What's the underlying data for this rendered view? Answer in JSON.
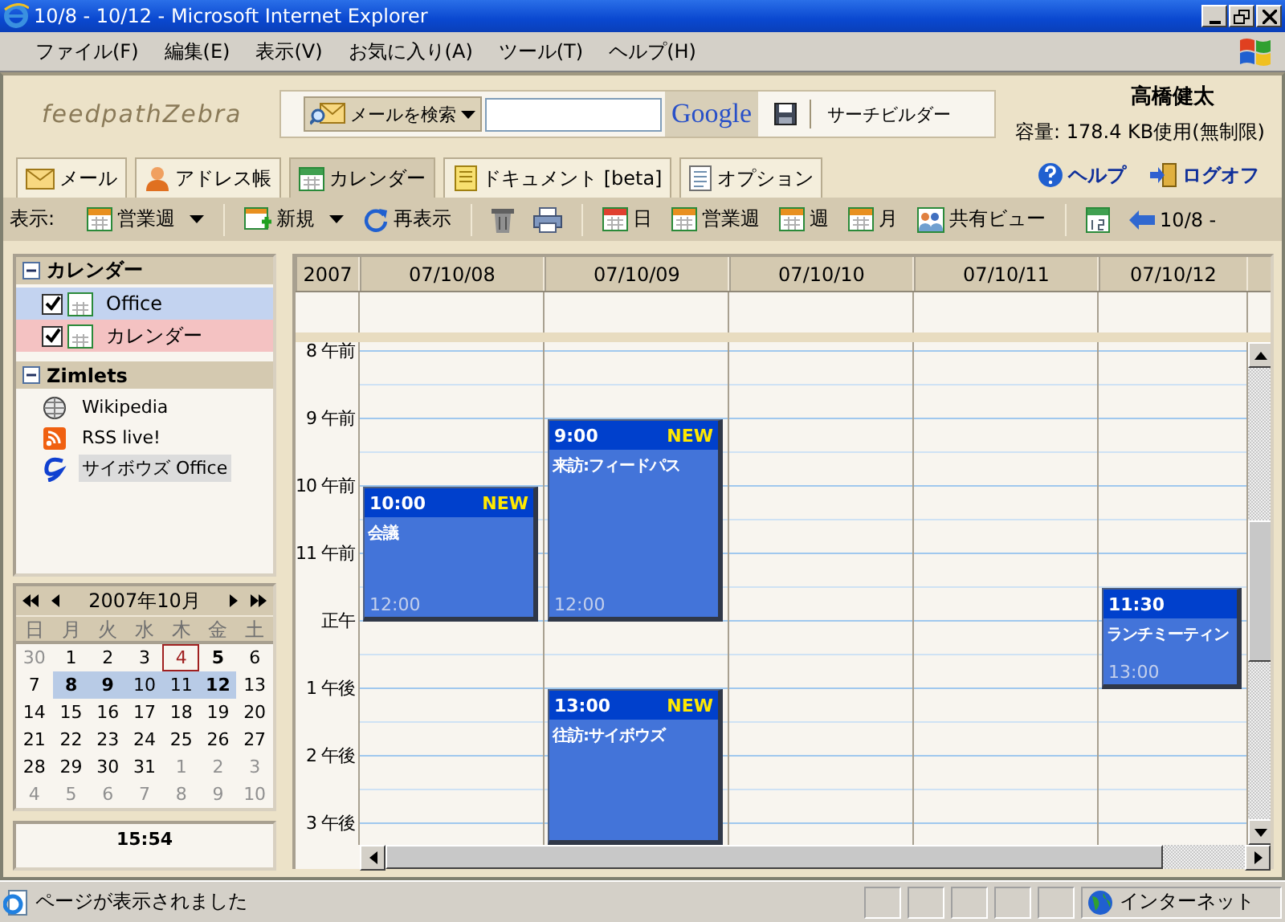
{
  "window": {
    "title": "10/8 - 10/12 - Microsoft Internet Explorer"
  },
  "menu": [
    "ファイル(F)",
    "編集(E)",
    "表示(V)",
    "お気に入り(A)",
    "ツール(T)",
    "ヘルプ(H)"
  ],
  "header": {
    "logo": "feedpathZebra",
    "search_scope": "メールを検索",
    "search_button": "Google",
    "search_builder": "サーチビルダー",
    "user": "高橋健太",
    "quota": "容量: 178.4 KB使用(無制限)"
  },
  "tabs": [
    {
      "label": "メール",
      "selected": false
    },
    {
      "label": "アドレス帳",
      "selected": false
    },
    {
      "label": "カレンダー",
      "selected": true
    },
    {
      "label": "ドキュメント [beta]",
      "selected": false
    },
    {
      "label": "オプション",
      "selected": false
    }
  ],
  "links": [
    "ヘルプ",
    "ログオフ"
  ],
  "toolbar": [
    {
      "kind": "label",
      "text": "表示:"
    },
    {
      "kind": "dropdown",
      "text": "営業週"
    },
    {
      "kind": "separator"
    },
    {
      "kind": "dropdown",
      "text": "新規"
    },
    {
      "kind": "button",
      "text": "再表示"
    },
    {
      "kind": "separator"
    },
    {
      "kind": "icon"
    },
    {
      "kind": "icon"
    },
    {
      "kind": "separator"
    },
    {
      "kind": "button",
      "text": "日"
    },
    {
      "kind": "button",
      "text": "営業週"
    },
    {
      "kind": "button",
      "text": "週"
    },
    {
      "kind": "button",
      "text": "月"
    },
    {
      "kind": "button",
      "text": "共有ビュー"
    },
    {
      "kind": "separator"
    },
    {
      "kind": "icon"
    },
    {
      "kind": "button",
      "text": "10/8 -"
    }
  ],
  "sidebar": {
    "calendars": {
      "title": "カレンダー",
      "items": [
        {
          "label": "Office",
          "checked": true,
          "color": "#c3d3f0"
        },
        {
          "label": "カレンダー",
          "checked": true,
          "color": "#f4c2c2"
        }
      ]
    },
    "zimlets": {
      "title": "Zimlets",
      "items": [
        {
          "label": "Wikipedia",
          "selected": false
        },
        {
          "label": "RSS live!",
          "selected": false
        },
        {
          "label": "サイボウズ Office",
          "selected": true
        }
      ]
    }
  },
  "mini_calendar": {
    "title": "2007年10月",
    "weekdays": [
      "日",
      "月",
      "火",
      "水",
      "木",
      "金",
      "土"
    ],
    "weeks": [
      [
        {
          "text": "30",
          "outside": true,
          "busy": false,
          "selected": false,
          "today": false
        },
        {
          "text": "1",
          "outside": false,
          "busy": false,
          "selected": false,
          "today": false
        },
        {
          "text": "2",
          "outside": false,
          "busy": false,
          "selected": false,
          "today": false
        },
        {
          "text": "3",
          "outside": false,
          "busy": false,
          "selected": false,
          "today": false
        },
        {
          "text": "4",
          "outside": false,
          "busy": false,
          "selected": false,
          "today": true
        },
        {
          "text": "5",
          "outside": false,
          "busy": true,
          "selected": false,
          "today": false
        },
        {
          "text": "6",
          "outside": false,
          "busy": false,
          "selected": false,
          "today": false
        }
      ],
      [
        {
          "text": "7",
          "outside": false,
          "busy": false,
          "selected": false,
          "today": false
        },
        {
          "text": "8",
          "outside": false,
          "busy": true,
          "selected": true,
          "today": false
        },
        {
          "text": "9",
          "outside": false,
          "busy": true,
          "selected": true,
          "today": false
        },
        {
          "text": "10",
          "outside": false,
          "busy": false,
          "selected": true,
          "today": false
        },
        {
          "text": "11",
          "outside": false,
          "busy": false,
          "selected": true,
          "today": false
        },
        {
          "text": "12",
          "outside": false,
          "busy": true,
          "selected": true,
          "today": false
        },
        {
          "text": "13",
          "outside": false,
          "busy": false,
          "selected": false,
          "today": false
        }
      ],
      [
        {
          "text": "14",
          "outside": false,
          "busy": false,
          "selected": false,
          "today": false
        },
        {
          "text": "15",
          "outside": false,
          "busy": false,
          "selected": false,
          "today": false
        },
        {
          "text": "16",
          "outside": false,
          "busy": false,
          "selected": false,
          "today": false
        },
        {
          "text": "17",
          "outside": false,
          "busy": false,
          "selected": false,
          "today": false
        },
        {
          "text": "18",
          "outside": false,
          "busy": false,
          "selected": false,
          "today": false
        },
        {
          "text": "19",
          "outside": false,
          "busy": false,
          "selected": false,
          "today": false
        },
        {
          "text": "20",
          "outside": false,
          "busy": false,
          "selected": false,
          "today": false
        }
      ],
      [
        {
          "text": "21",
          "outside": false,
          "busy": false,
          "selected": false,
          "today": false
        },
        {
          "text": "22",
          "outside": false,
          "busy": false,
          "selected": false,
          "today": false
        },
        {
          "text": "23",
          "outside": false,
          "busy": false,
          "selected": false,
          "today": false
        },
        {
          "text": "24",
          "outside": false,
          "busy": false,
          "selected": false,
          "today": false
        },
        {
          "text": "25",
          "outside": false,
          "busy": false,
          "selected": false,
          "today": false
        },
        {
          "text": "26",
          "outside": false,
          "busy": false,
          "selected": false,
          "today": false
        },
        {
          "text": "27",
          "outside": false,
          "busy": false,
          "selected": false,
          "today": false
        }
      ],
      [
        {
          "text": "28",
          "outside": false,
          "busy": false,
          "selected": false,
          "today": false
        },
        {
          "text": "29",
          "outside": false,
          "busy": false,
          "selected": false,
          "today": false
        },
        {
          "text": "30",
          "outside": false,
          "busy": false,
          "selected": false,
          "today": false
        },
        {
          "text": "31",
          "outside": false,
          "busy": false,
          "selected": false,
          "today": false
        },
        {
          "text": "1",
          "outside": true,
          "busy": false,
          "selected": false,
          "today": false
        },
        {
          "text": "2",
          "outside": true,
          "busy": false,
          "selected": false,
          "today": false
        },
        {
          "text": "3",
          "outside": true,
          "busy": false,
          "selected": false,
          "today": false
        }
      ],
      [
        {
          "text": "4",
          "outside": true,
          "busy": false,
          "selected": false,
          "today": false
        },
        {
          "text": "5",
          "outside": true,
          "busy": false,
          "selected": false,
          "today": false
        },
        {
          "text": "6",
          "outside": true,
          "busy": false,
          "selected": false,
          "today": false
        },
        {
          "text": "7",
          "outside": true,
          "busy": false,
          "selected": false,
          "today": false
        },
        {
          "text": "8",
          "outside": true,
          "busy": false,
          "selected": false,
          "today": false
        },
        {
          "text": "9",
          "outside": true,
          "busy": false,
          "selected": false,
          "today": false
        },
        {
          "text": "10",
          "outside": true,
          "busy": false,
          "selected": false,
          "today": false
        }
      ]
    ]
  },
  "clock": "15:54",
  "calendar": {
    "year": "2007",
    "hours": [
      "8 午前",
      "9 午前",
      "10 午前",
      "11 午前",
      "正午",
      "1 午後",
      "2 午後",
      "3 午後"
    ],
    "days": [
      {
        "date": "07/10/08",
        "events": [
          {
            "start": "10:00",
            "end": "12:00",
            "title": "会議",
            "badge": "NEW"
          }
        ]
      },
      {
        "date": "07/10/09",
        "events": [
          {
            "start": "9:00",
            "end": "12:00",
            "title": "来訪:フィードパス",
            "badge": "NEW"
          },
          {
            "start": "13:00",
            "title": "往訪:サイボウズ",
            "badge": "NEW"
          }
        ]
      },
      {
        "date": "07/10/10"
      },
      {
        "date": "07/10/11"
      },
      {
        "date": "07/10/12",
        "events": [
          {
            "start": "11:30",
            "end": "13:00",
            "title": "ランチミーティン"
          }
        ]
      }
    ]
  },
  "status_bar": {
    "text": "ページが表示されました",
    "zone": "インターネット"
  }
}
